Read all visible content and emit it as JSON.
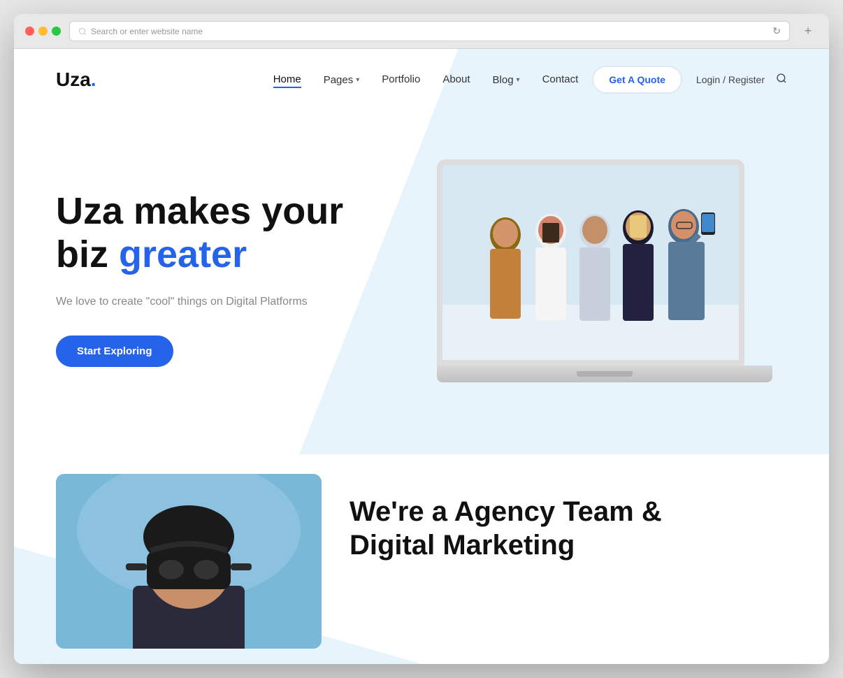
{
  "browser": {
    "address_placeholder": "Search or enter website name",
    "new_tab_label": "+"
  },
  "logo": {
    "text": "Uza",
    "dot": "."
  },
  "nav": {
    "items": [
      {
        "label": "Home",
        "active": true,
        "has_dropdown": false
      },
      {
        "label": "Pages",
        "active": false,
        "has_dropdown": true
      },
      {
        "label": "Portfolio",
        "active": false,
        "has_dropdown": false
      },
      {
        "label": "About",
        "active": false,
        "has_dropdown": false
      },
      {
        "label": "Blog",
        "active": false,
        "has_dropdown": true
      },
      {
        "label": "Contact",
        "active": false,
        "has_dropdown": false
      }
    ],
    "cta_label": "Get A Quote",
    "login_label": "Login",
    "register_label": "Register",
    "auth_separator": " / "
  },
  "hero": {
    "title_line1": "Uza makes your",
    "title_line2_prefix": "biz ",
    "title_line2_highlight": "greater",
    "subtitle": "We love to create \"cool\" things on Digital Platforms",
    "cta_label": "Start Exploring"
  },
  "about_section": {
    "title_line1": "We're a Agency Team &",
    "title_line2": "Digital Marketing"
  },
  "colors": {
    "accent": "#2563eb",
    "bg_light": "#e8f4fc",
    "text_dark": "#111111",
    "text_gray": "#888888"
  }
}
